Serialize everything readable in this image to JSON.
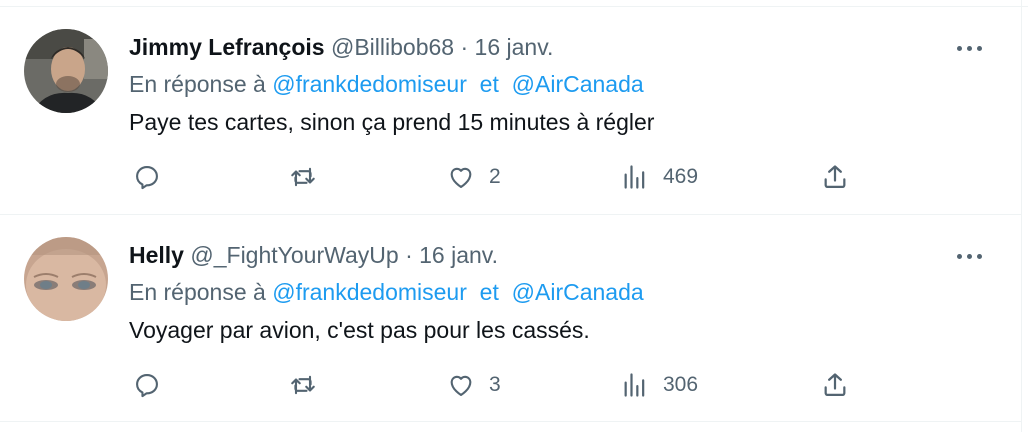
{
  "tweets": [
    {
      "name": "Jimmy Lefrançois",
      "handle": "@Billibob68",
      "separator": "·",
      "date": "16 janv.",
      "reply_prefix": "En réponse à",
      "mention1": "@frankdedomiseur",
      "conjunction": "et",
      "mention2": "@AirCanada",
      "text": "Paye tes cartes, sinon ça prend 15 minutes à régler",
      "likes": "2",
      "views": "469"
    },
    {
      "name": "Helly",
      "handle": "@_FightYourWayUp",
      "separator": "·",
      "date": "16 janv.",
      "reply_prefix": "En réponse à",
      "mention1": "@frankdedomiseur",
      "conjunction": "et",
      "mention2": "@AirCanada",
      "text": "Voyager par avion, c'est pas pour les cassés.",
      "likes": "3",
      "views": "306"
    }
  ],
  "icons": {
    "reply": "reply-icon",
    "retweet": "retweet-icon",
    "like": "heart-icon",
    "views": "views-chart-icon",
    "share": "share-icon",
    "more": "more-options-icon"
  },
  "colors": {
    "text": "#0f1419",
    "secondary": "#536471",
    "link": "#1d9bf0",
    "divider": "#eff3f4"
  }
}
